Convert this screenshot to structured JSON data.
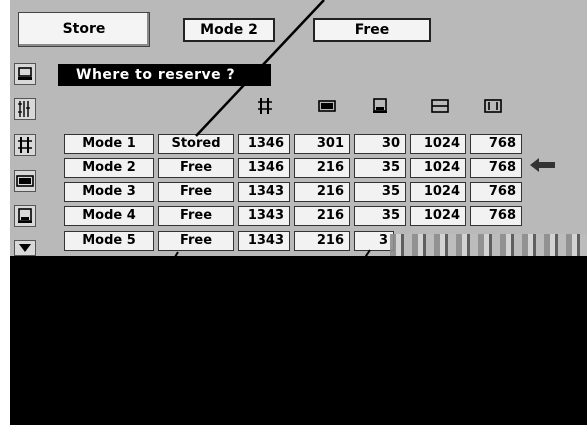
{
  "tabs": {
    "store": "Store",
    "mode": "Mode 2",
    "free": "Free"
  },
  "dialog": {
    "title": "Where to reserve ?"
  },
  "rows": [
    {
      "mode": "Mode 1",
      "status": "Stored",
      "v1": "1346",
      "v2": "301",
      "v3": "30",
      "v4": "1024",
      "v5": "768"
    },
    {
      "mode": "Mode 2",
      "status": "Free",
      "v1": "1346",
      "v2": "216",
      "v3": "35",
      "v4": "1024",
      "v5": "768"
    },
    {
      "mode": "Mode 3",
      "status": "Free",
      "v1": "1343",
      "v2": "216",
      "v3": "35",
      "v4": "1024",
      "v5": "768"
    },
    {
      "mode": "Mode 4",
      "status": "Free",
      "v1": "1343",
      "v2": "216",
      "v3": "35",
      "v4": "1024",
      "v5": "768"
    },
    {
      "mode": "Mode 5",
      "status": "Free",
      "v1": "1343",
      "v2": "216",
      "v3": "3",
      "v4": "",
      "v5": ""
    }
  ],
  "icons": {
    "side": [
      "monitor-icon",
      "vertical-lines-icon",
      "total-dots-icon",
      "horizontal-position-icon",
      "vertical-position-icon",
      "scroll-down-icon"
    ],
    "columns": [
      "total-dots-icon",
      "horizontal-position-icon",
      "vertical-position-icon",
      "display-area-h-icon",
      "display-area-v-icon"
    ],
    "pointer": "left-arrow-icon"
  },
  "colors": {
    "panel": "#b9b9b9",
    "cell": "#f2f2f2",
    "title_bar": "#000000"
  }
}
